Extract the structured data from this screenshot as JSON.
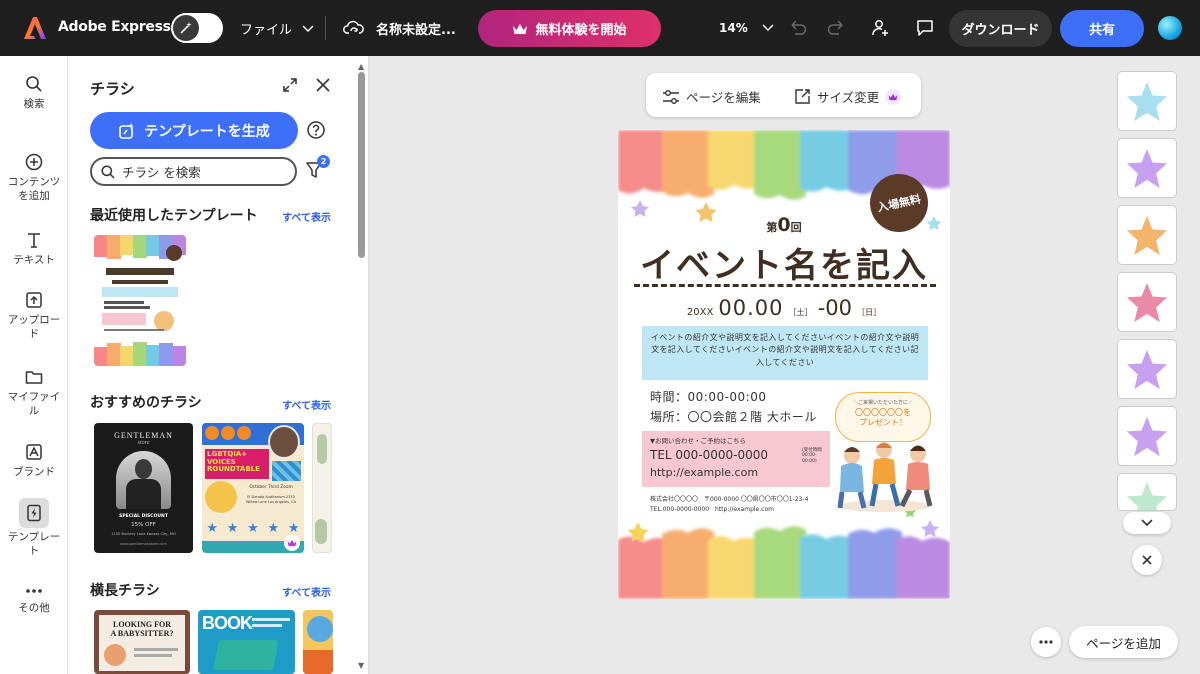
{
  "topbar": {
    "app_name": "Adobe Express",
    "file_menu": "ファイル",
    "doc_name": "名称未設定...",
    "trial_button": "無料体験を開始",
    "zoom": "14%",
    "download": "ダウンロード",
    "share": "共有"
  },
  "rail": {
    "items": [
      {
        "label": "検索",
        "icon": "search-icon"
      },
      {
        "label": "コンテンツ\nを追加",
        "icon": "plus-circle-icon"
      },
      {
        "label": "テキスト",
        "icon": "text-icon"
      },
      {
        "label": "アップロー\nド",
        "icon": "upload-icon"
      },
      {
        "label": "マイファイ\nル",
        "icon": "folder-icon"
      },
      {
        "label": "ブランド",
        "icon": "brand-icon"
      },
      {
        "label": "テンプレー\nト",
        "icon": "template-icon"
      },
      {
        "label": "その他",
        "icon": "more-icon"
      }
    ]
  },
  "panel": {
    "title": "チラシ",
    "generate_button": "テンプレートを生成",
    "search_placeholder": "チラシ を検索",
    "filter_badge": "2",
    "sections": [
      {
        "title": "最近使用したテンプレート",
        "link": "すべて表示"
      },
      {
        "title": "おすすめのチラシ",
        "link": "すべて表示"
      },
      {
        "title": "横長チラシ",
        "link": "すべて表示"
      }
    ],
    "thumbs": {
      "recent": {
        "badge": "入場無料",
        "nth": "第0回",
        "title": "イベント名を記入",
        "date": "20XX 00.00 (土) -00 (日)",
        "rows": [
          "時間：00:00-00:00",
          "場所：〇〇会館２階 大ホール",
          "TEL 000-0000-0000"
        ]
      },
      "gentleman": {
        "title": "GENTLEMAN",
        "subtitle": "store",
        "discount": "SPECIAL DISCOUNT",
        "off": "15% OFF",
        "address": "1150 Buckley Lane Kansas City, MO",
        "url": "www.gentlemanstore.com"
      },
      "lgbt": {
        "line1": "LGBTQIA+",
        "line2": "VOICES",
        "line3": "ROUNDTABLE",
        "info": "October Third Zoom",
        "addr": "El Dorado Auditorium 2153 Willow Lane Los Angeles, CA"
      },
      "babysitter": {
        "line1": "LOOKING FOR",
        "line2": "A BABYSITTER?"
      },
      "book": {
        "title": "BOOK"
      }
    }
  },
  "canvas": {
    "edit_page": "ページを編集",
    "resize": "サイズ変更",
    "add_page": "ページを追加"
  },
  "flyer": {
    "badge": "入場無料",
    "nth_pre": "第",
    "nth_num": "0",
    "nth_post": "回",
    "title": "イベント名を記入",
    "date_year": "20XX",
    "date_main": "00.00",
    "date_sat": "［土］",
    "date_dash": "-00",
    "date_sun": "［日］",
    "intro": "イベントの紹介文や説明文を記入してくださいイベントの紹介文や説明文を記入してくださいイベントの紹介文や説明文を記入してください記入してください",
    "time": "時間：00:00-00:00",
    "place": "場所：〇〇会館２階 大ホール",
    "bubble_small": "＼ご来場いただいた方に／",
    "bubble_main": "〇〇〇〇〇〇を\nプレゼント！",
    "contact_label": "▼お問い合わせ・ご予約はこちら",
    "tel": "TEL 000-0000-0000",
    "tel_note": "(受付時間\n00:00-00:00)",
    "url": "http://example.com",
    "footer1": "株式会社〇〇〇〇　〒000-0000 〇〇県〇〇市〇〇1-23-4",
    "footer2": "TEL.000-0000-0000　http://example.com"
  },
  "colors": {
    "accent": "#3d6ff8",
    "topbar": "#1f1f1f",
    "trial_gradient": [
      "#b1257e",
      "#e0306a"
    ],
    "page_stars": [
      "#a8dff0",
      "#c7a0f0",
      "#f4b46c",
      "#e98aa6",
      "#c7a0f0",
      "#c7a0f0",
      "#bfe8cf"
    ]
  }
}
